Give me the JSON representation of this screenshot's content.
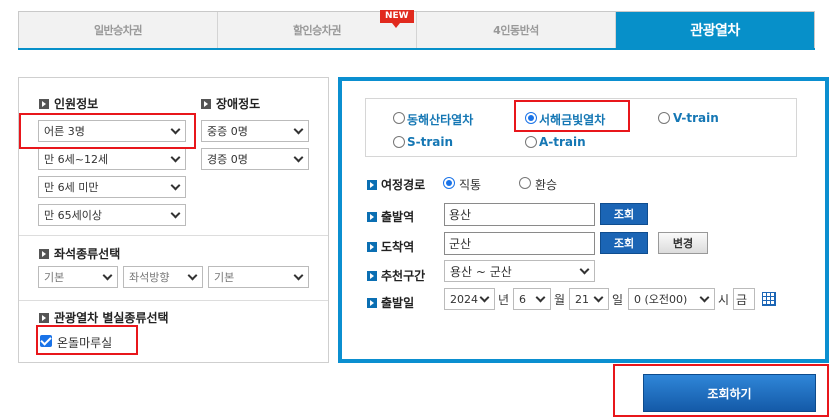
{
  "tabs": [
    {
      "label": "일반승차권"
    },
    {
      "label": "할인승차권",
      "badge": "NEW"
    },
    {
      "label": "4인동반석"
    },
    {
      "label": "관광열차"
    }
  ],
  "left": {
    "passenger_title": "인원정보",
    "disability_title": "장애정도",
    "adult": "어른 3명",
    "child": "만 6세~12세",
    "infant": "만 6세 미만",
    "senior": "만 65세이상",
    "severe": "중증 0명",
    "mild": "경증 0명",
    "seat_title": "좌석종류선택",
    "seat_type": "기본",
    "seat_direction": "좌석방향",
    "seat_extra": "기본",
    "room_title": "관광열차 별실종류선택",
    "room_option": "온돌마루실",
    "room_checked": true
  },
  "right": {
    "trains": [
      {
        "label": "동해산타열차",
        "selected": false
      },
      {
        "label": "서해금빛열차",
        "selected": true
      },
      {
        "label": "V-train",
        "selected": false
      },
      {
        "label": "S-train",
        "selected": false
      },
      {
        "label": "A-train",
        "selected": false
      }
    ],
    "route_label": "여정경로",
    "route_direct": "직통",
    "route_transfer": "환승",
    "departure_label": "출발역",
    "departure_value": "용산",
    "arrival_label": "도착역",
    "arrival_value": "군산",
    "recommend_label": "추천구간",
    "recommend_value": "용산 ~ 군산",
    "date_label": "출발일",
    "year": "2024",
    "year_unit": "년",
    "month": "6",
    "month_unit": "월",
    "day": "21",
    "day_unit": "일",
    "hour": "0 (오전00)",
    "hour_unit": "시",
    "weekday": "금",
    "lookup_button": "조회",
    "lookup_button2": "조회",
    "change_button": "변경"
  },
  "search_button": "조회하기",
  "colors": {
    "accent": "#0790c9",
    "button": "#1b65b5",
    "highlight": "#e8161b"
  }
}
